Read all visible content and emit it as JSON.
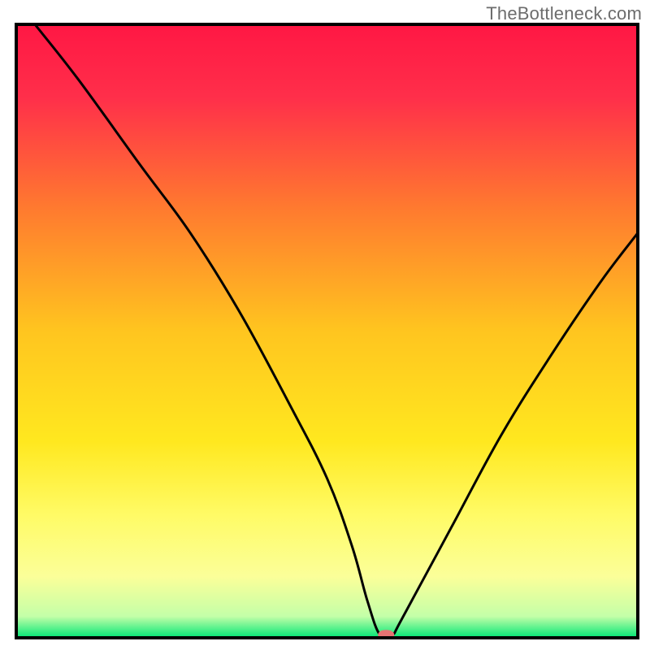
{
  "watermark": "TheBottleneck.com",
  "chart_data": {
    "type": "line",
    "title": "",
    "xlabel": "",
    "ylabel": "",
    "xlim": [
      0,
      100
    ],
    "ylim": [
      0,
      100
    ],
    "grid": false,
    "legend": false,
    "background_gradient_stops": [
      {
        "offset": 0.0,
        "color": "#ff1744"
      },
      {
        "offset": 0.12,
        "color": "#ff2f4a"
      },
      {
        "offset": 0.3,
        "color": "#ff7a2f"
      },
      {
        "offset": 0.5,
        "color": "#ffc51f"
      },
      {
        "offset": 0.68,
        "color": "#ffe81f"
      },
      {
        "offset": 0.8,
        "color": "#fffb66"
      },
      {
        "offset": 0.9,
        "color": "#fbff99"
      },
      {
        "offset": 0.965,
        "color": "#c4ffa8"
      },
      {
        "offset": 1.0,
        "color": "#00e676"
      }
    ],
    "series": [
      {
        "name": "bottleneck-curve",
        "type": "line",
        "color": "#000000",
        "x": [
          3,
          10,
          20,
          28,
          36,
          44,
          50,
          54,
          56.5,
          58.5,
          60.5,
          62,
          70,
          78,
          86,
          94,
          100
        ],
        "y": [
          100,
          91,
          77,
          66,
          53,
          38,
          26,
          15,
          6,
          0.5,
          0.5,
          3,
          18,
          33,
          46,
          58,
          66
        ]
      }
    ],
    "marker": {
      "name": "bottleneck-point",
      "x": 59.5,
      "y": 0.5,
      "color": "#e57373",
      "rx": 10,
      "ry": 6
    },
    "frame": {
      "inset_left": 20,
      "inset_right": 15,
      "inset_top": 30,
      "inset_bottom": 15,
      "stroke": "#000000",
      "stroke_width": 4
    }
  }
}
